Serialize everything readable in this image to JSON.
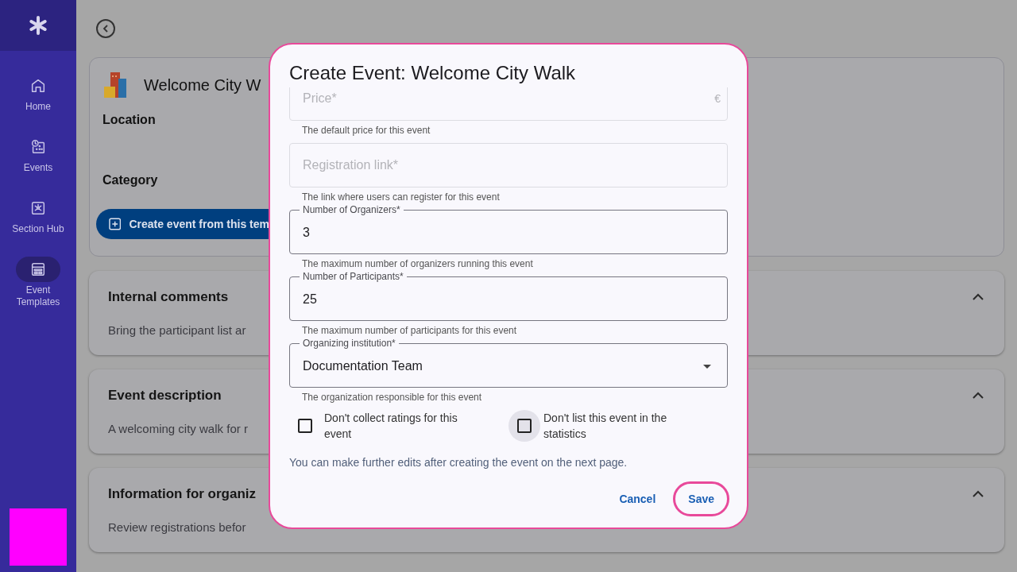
{
  "sidebar": {
    "items": [
      {
        "label": "Home",
        "selected": false
      },
      {
        "label": "Events",
        "selected": false
      },
      {
        "label": "Section Hub",
        "selected": false
      },
      {
        "label": "Event Templates",
        "selected": true
      }
    ]
  },
  "template": {
    "title": "Welcome City W",
    "fields": [
      "Location",
      "Category"
    ],
    "create_button": "Create event from this tem"
  },
  "sections": [
    {
      "title": "Internal comments",
      "text": "Bring the participant list ar",
      "expanded": true
    },
    {
      "title": "Event description",
      "text": "A welcoming city walk for r",
      "expanded": true
    },
    {
      "title": "Information for organiz",
      "text": "Review registrations befor",
      "expanded": true
    }
  ],
  "dialog": {
    "title": "Create Event: Welcome City Walk",
    "fields": [
      {
        "kind": "price",
        "placeholder": "Price*",
        "suffix": "€",
        "helper": "The default price for this event"
      },
      {
        "kind": "text",
        "placeholder": "Registration link*",
        "helper": "The link where users can register for this event"
      },
      {
        "kind": "filled",
        "label": "Number of Organizers*",
        "value": "3",
        "helper": "The maximum number of organizers running this event"
      },
      {
        "kind": "filled",
        "label": "Number of Participants*",
        "value": "25",
        "helper": "The maximum number of participants for this event"
      },
      {
        "kind": "select",
        "label": "Organizing institution*",
        "value": "Documentation Team",
        "helper": "The organization responsible for this event"
      }
    ],
    "checkboxes": [
      {
        "label": "Don't collect ratings for this event",
        "checked": false,
        "focused": false
      },
      {
        "label": "Don't list this event in the statistics",
        "checked": false,
        "focused": true
      }
    ],
    "note": "You can make further edits after creating the event on the next page.",
    "buttons": [
      {
        "label": "Cancel",
        "focused": false
      },
      {
        "label": "Save",
        "focused": true
      }
    ]
  }
}
